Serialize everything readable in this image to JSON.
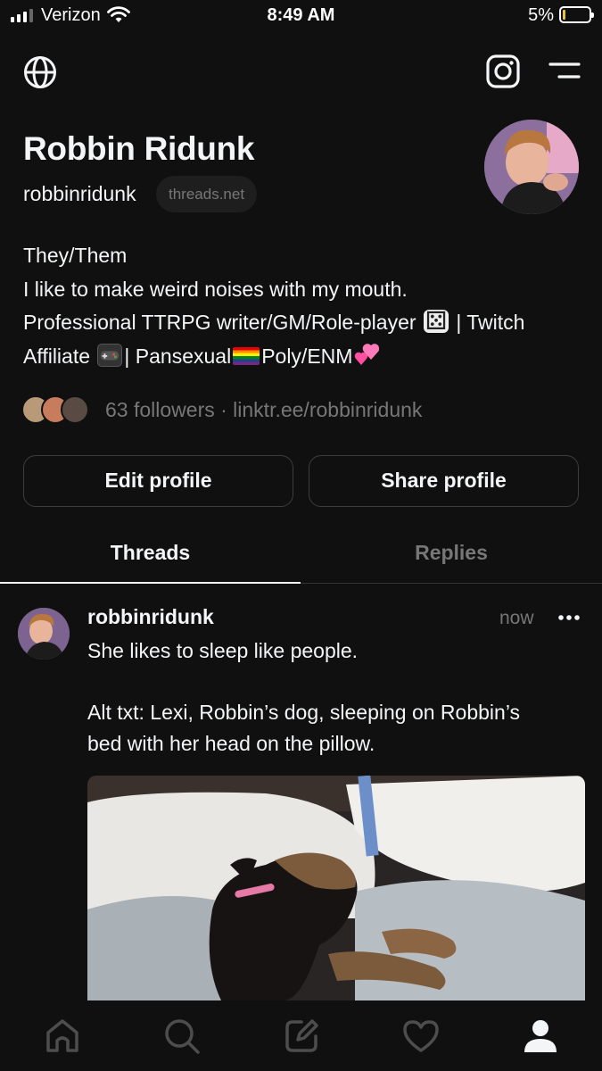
{
  "status_bar": {
    "carrier": "Verizon",
    "time": "8:49 AM",
    "battery_percent": "5%",
    "battery_level": 0.05
  },
  "top_nav": {
    "icons": [
      "globe-icon",
      "instagram-icon",
      "menu-icon"
    ]
  },
  "profile": {
    "name": "Robbin Ridunk",
    "handle": "robbinridunk",
    "domain_chip": "threads.net",
    "bio": {
      "line1": "They/Them",
      "line2": "I like to make weird noises with my mouth.",
      "line3_a": "Professional TTRPG writer/GM/Role-player",
      "line3_b": "| Twitch",
      "line4_a": "Affiliate",
      "line4_b": "| Pansexual",
      "line4_c": "Poly/ENM",
      "emojis": [
        "game-die",
        "video-game-controller",
        "rainbow-flag",
        "two-hearts"
      ]
    },
    "followers_text": "63 followers · linktr.ee/robbinridunk",
    "edit_button": "Edit profile",
    "share_button": "Share profile"
  },
  "tabs": [
    {
      "label": "Threads",
      "active": true
    },
    {
      "label": "Replies",
      "active": false
    }
  ],
  "post": {
    "username": "robbinridunk",
    "time": "now",
    "text_line1": "She likes to sleep like people.",
    "text_line2": "",
    "text_line3": "Alt txt: Lexi, Robbin’s dog, sleeping on Robbin’s",
    "text_line4": "bed with her head on the pillow."
  },
  "bottom_nav": {
    "items": [
      "home-icon",
      "search-icon",
      "compose-icon",
      "activity-heart-icon",
      "profile-icon"
    ],
    "active": "profile-icon"
  },
  "colors": {
    "background": "#101010",
    "text_primary": "#f3f5f7",
    "text_secondary": "#777777",
    "border": "#3d3d3d"
  }
}
